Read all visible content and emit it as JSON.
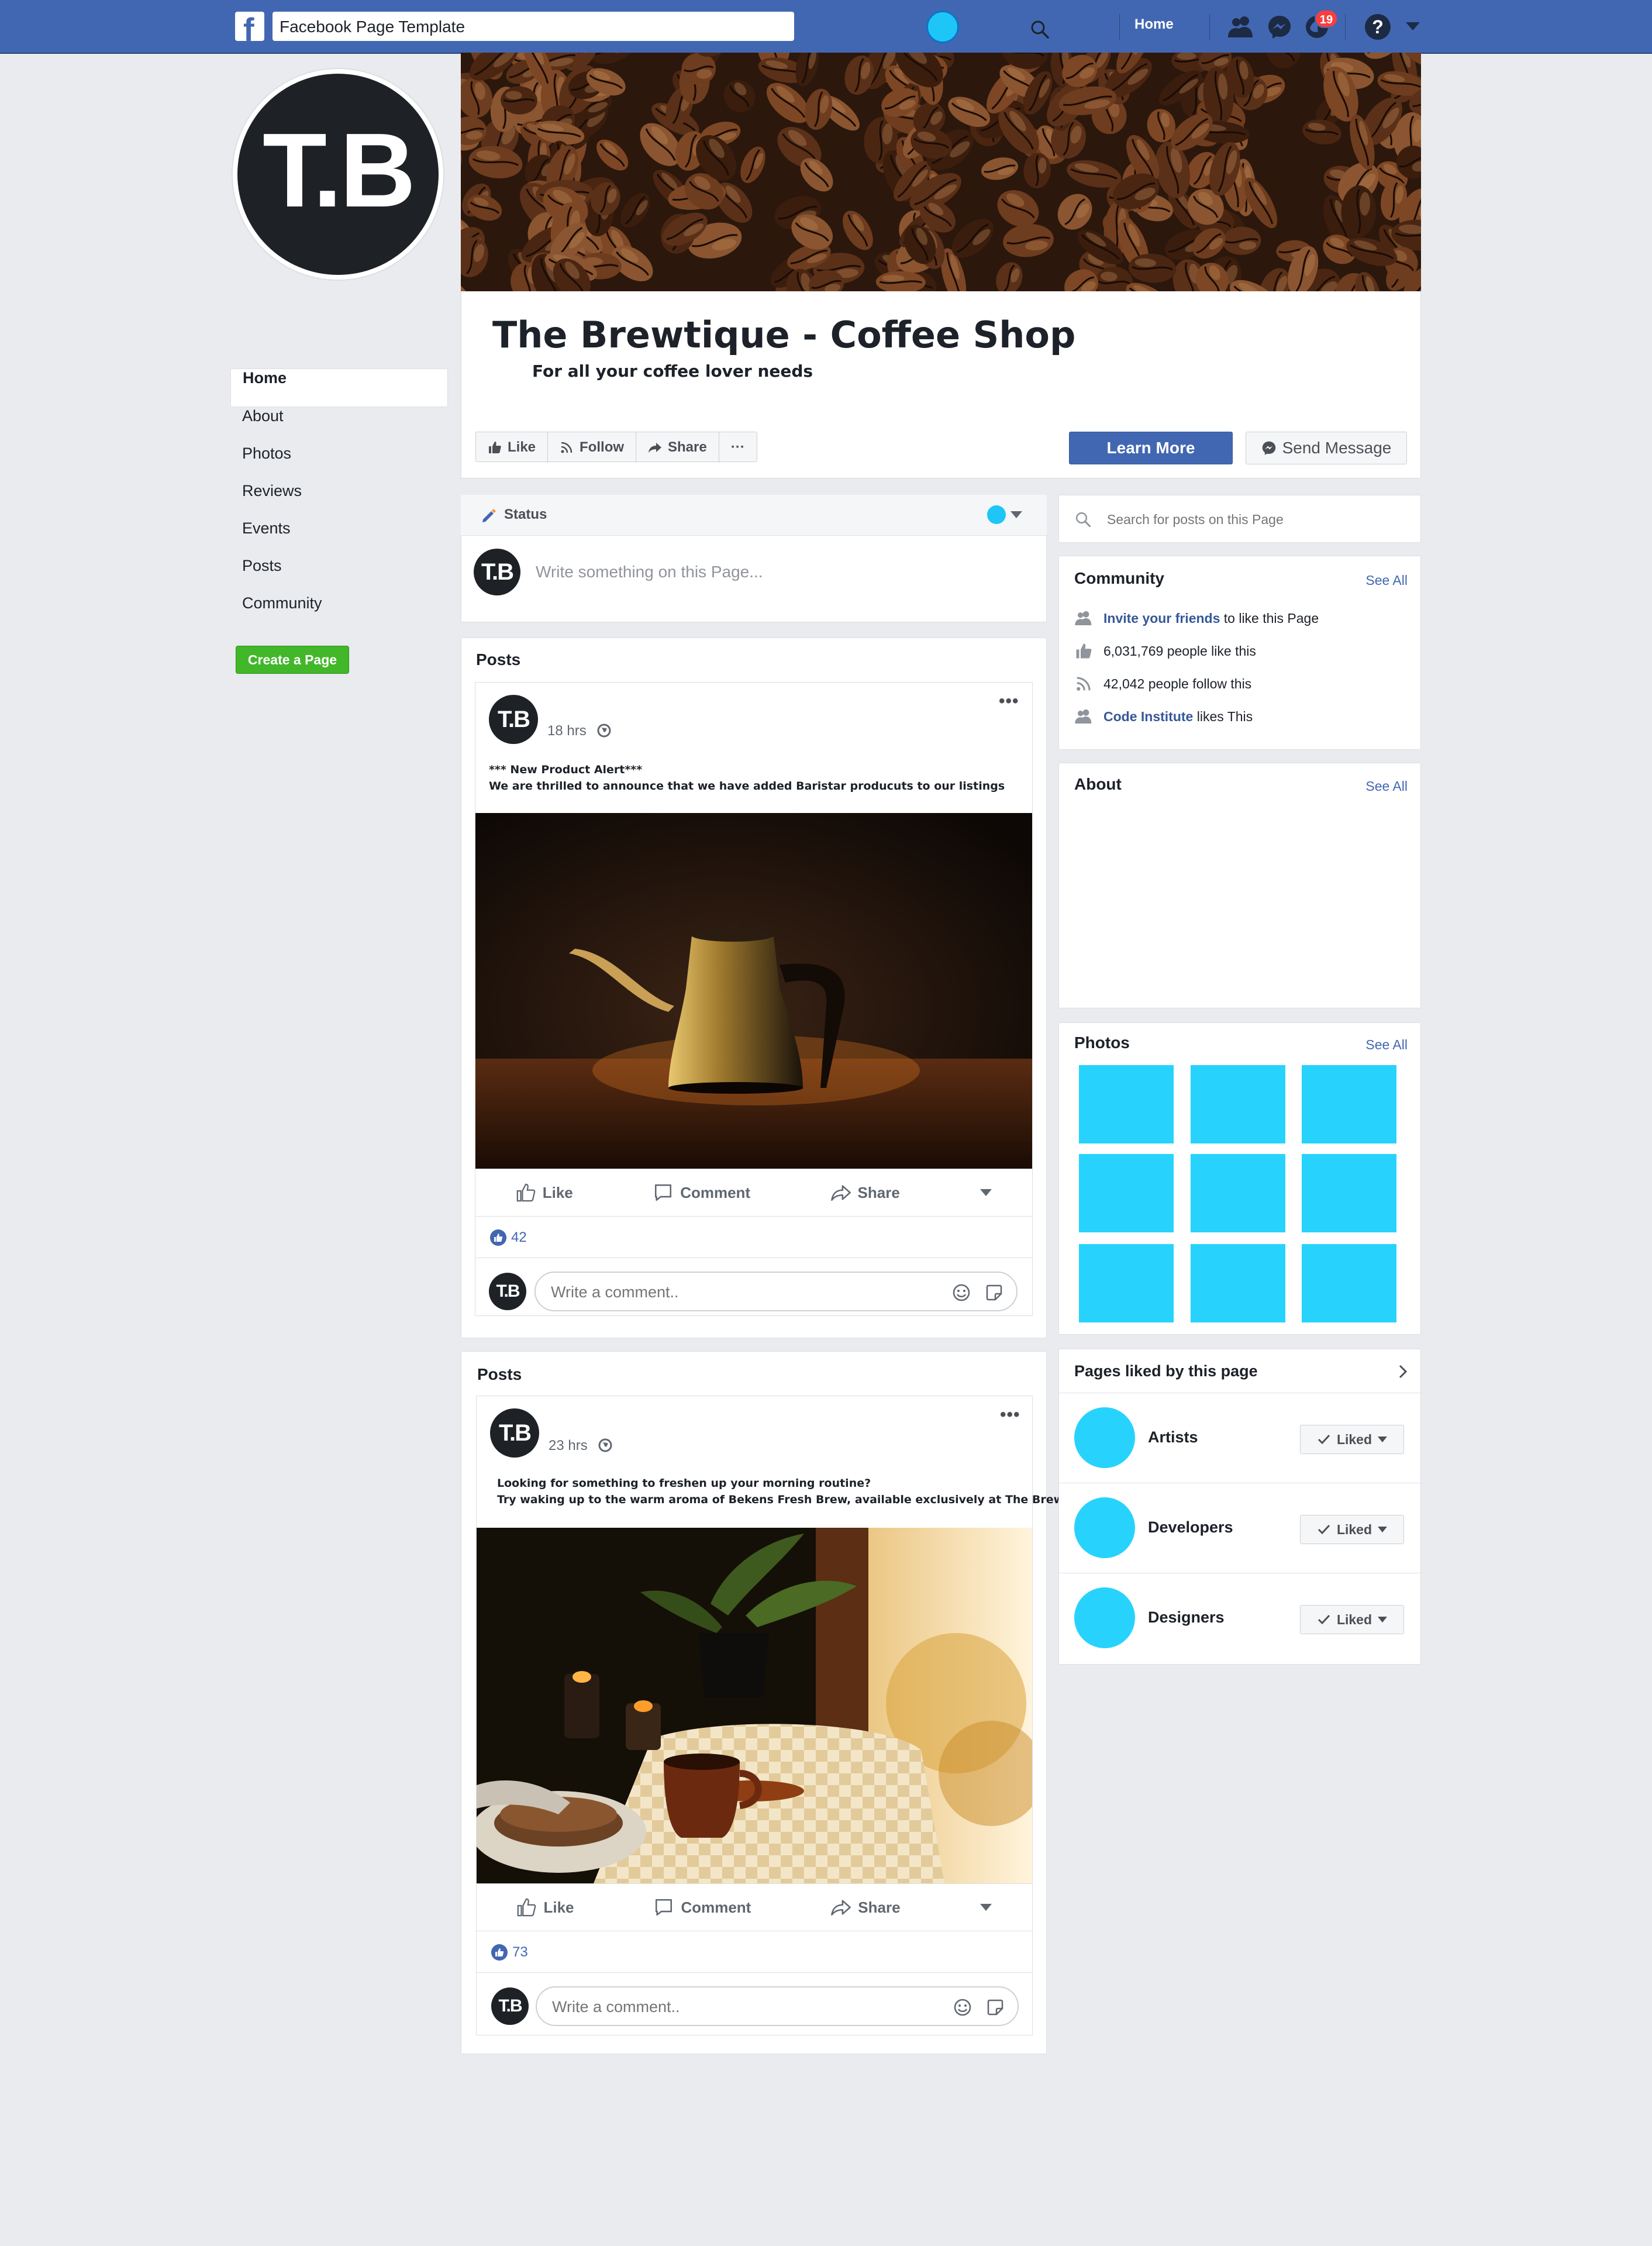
{
  "topbar": {
    "search_value": "Facebook Page Template",
    "home_label": "Home",
    "notification_count": "19",
    "help_glyph": "?",
    "icons": [
      "facebook-logo-icon",
      "search-icon",
      "friends-icon",
      "messenger-icon",
      "notifications-icon",
      "help-icon",
      "caret-down-icon"
    ],
    "brand_color": "#4267b2"
  },
  "profile": {
    "initials": "T.B",
    "page_name": "The Brewtique - Coffee Shop",
    "tagline": "For all your coffee lover needs"
  },
  "left_nav": {
    "items": [
      {
        "label": "Home",
        "active": true
      },
      {
        "label": "About"
      },
      {
        "label": "Photos"
      },
      {
        "label": "Reviews"
      },
      {
        "label": "Events"
      },
      {
        "label": "Posts"
      },
      {
        "label": "Community"
      }
    ],
    "create_page_label": "Create a Page"
  },
  "header_actions": {
    "like_label": "Like",
    "follow_label": "Follow",
    "share_label": "Share",
    "more_label": "···",
    "learn_more_label": "Learn More",
    "send_message_label": "Send Message"
  },
  "composer": {
    "tab_label": "Status",
    "placeholder": "Write something on this Page..."
  },
  "posts": [
    {
      "heading": "Posts",
      "time": "18 hrs",
      "text_line1": "*** New Product Alert***",
      "text_line2": "We are thrilled to announce that we have added Baristar producuts to our listings",
      "like_label": "Like",
      "comment_label": "Comment",
      "share_label": "Share",
      "likes": "42",
      "comment_placeholder": "Write a comment.."
    },
    {
      "heading": "Posts",
      "time": "23 hrs",
      "text_line1": "Looking for something to freshen up your morning routine?",
      "text_line2": "Try waking up to the warm aroma of Bekens Fresh Brew, available exclusively at The Brewtique",
      "like_label": "Like",
      "comment_label": "Comment",
      "share_label": "Share",
      "likes": "73",
      "comment_placeholder": "Write a comment.."
    }
  ],
  "sidebar": {
    "search_placeholder": "Search for posts on this Page",
    "community": {
      "title": "Community",
      "see_all": "See All",
      "invite_link": "Invite your friends",
      "invite_rest": " to like this Page",
      "likes_text": "6,031,769 people like this",
      "follows_text": "42,042 people follow this",
      "friend_link": "Code Institute",
      "friend_rest": " likes This"
    },
    "about": {
      "title": "About",
      "see_all": "See All"
    },
    "photos": {
      "title": "Photos",
      "see_all": "See All",
      "tile_color": "#27d3fd"
    },
    "pages_liked": {
      "title": "Pages liked by this page",
      "items": [
        {
          "name": "Artists",
          "button": "Liked"
        },
        {
          "name": "Developers",
          "button": "Liked"
        },
        {
          "name": "Designers",
          "button": "Liked"
        }
      ]
    }
  }
}
